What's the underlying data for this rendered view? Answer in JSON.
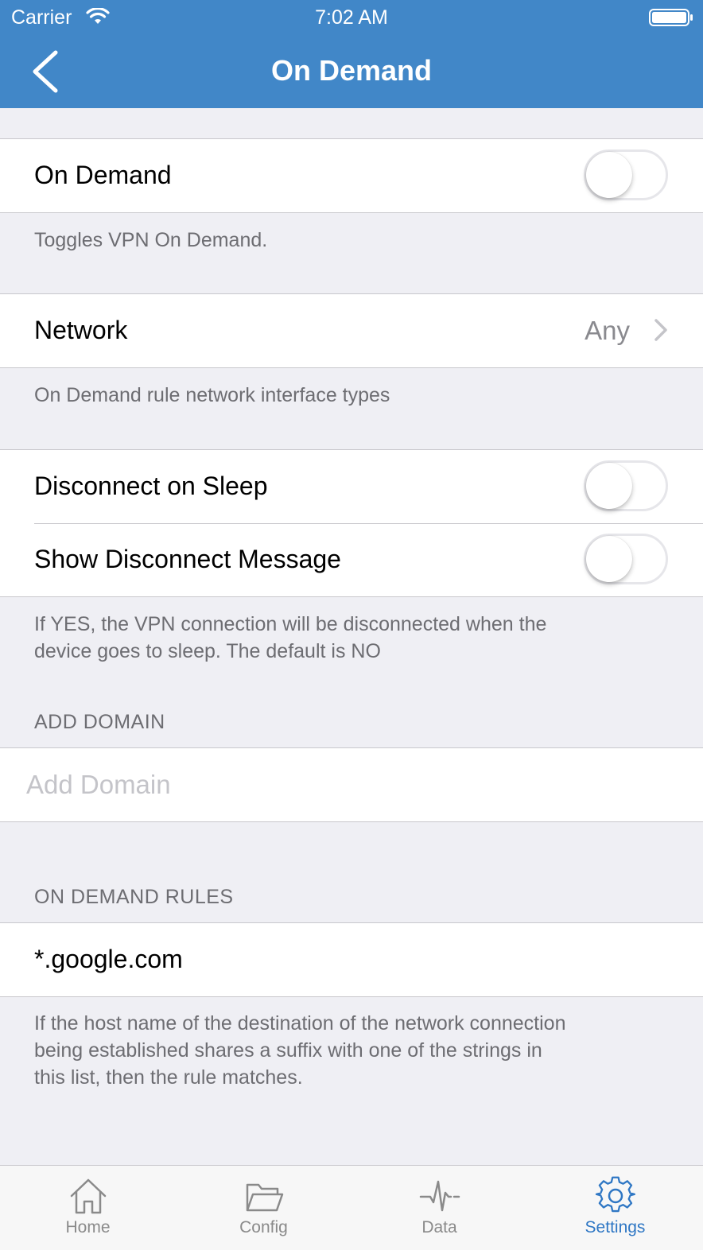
{
  "status_bar": {
    "carrier": "Carrier",
    "time": "7:02 AM"
  },
  "nav": {
    "title": "On Demand",
    "back_icon": "chevron-left-icon"
  },
  "on_demand": {
    "label": "On Demand",
    "enabled": false,
    "footer": "Toggles VPN On Demand."
  },
  "network": {
    "label": "Network",
    "value": "Any",
    "footer": "On Demand rule network interface types"
  },
  "sleep": {
    "disconnect_label": "Disconnect on Sleep",
    "disconnect_enabled": false,
    "message_label": "Show Disconnect Message",
    "message_enabled": false,
    "footer_line1": "If YES, the VPN connection will be disconnected when the",
    "footer_line2": "device goes to sleep. The default is NO"
  },
  "add_domain": {
    "header": "ADD DOMAIN",
    "placeholder": "Add Domain",
    "value": ""
  },
  "rules": {
    "header": "ON DEMAND RULES",
    "items": [
      "*.google.com"
    ],
    "footer_line1": "If the host name of the destination of the network connection",
    "footer_line2": "being established shares a suffix with one of the strings in",
    "footer_line3": "this list, then the rule matches."
  },
  "tabs": [
    {
      "label": "Home",
      "icon": "home-icon"
    },
    {
      "label": "Config",
      "icon": "folder-icon"
    },
    {
      "label": "Data",
      "icon": "activity-icon"
    },
    {
      "label": "Settings",
      "icon": "gear-icon",
      "active": true
    }
  ],
  "colors": {
    "accent": "#4187c8",
    "tab_active": "#2f77c4",
    "background": "#efeff4"
  }
}
